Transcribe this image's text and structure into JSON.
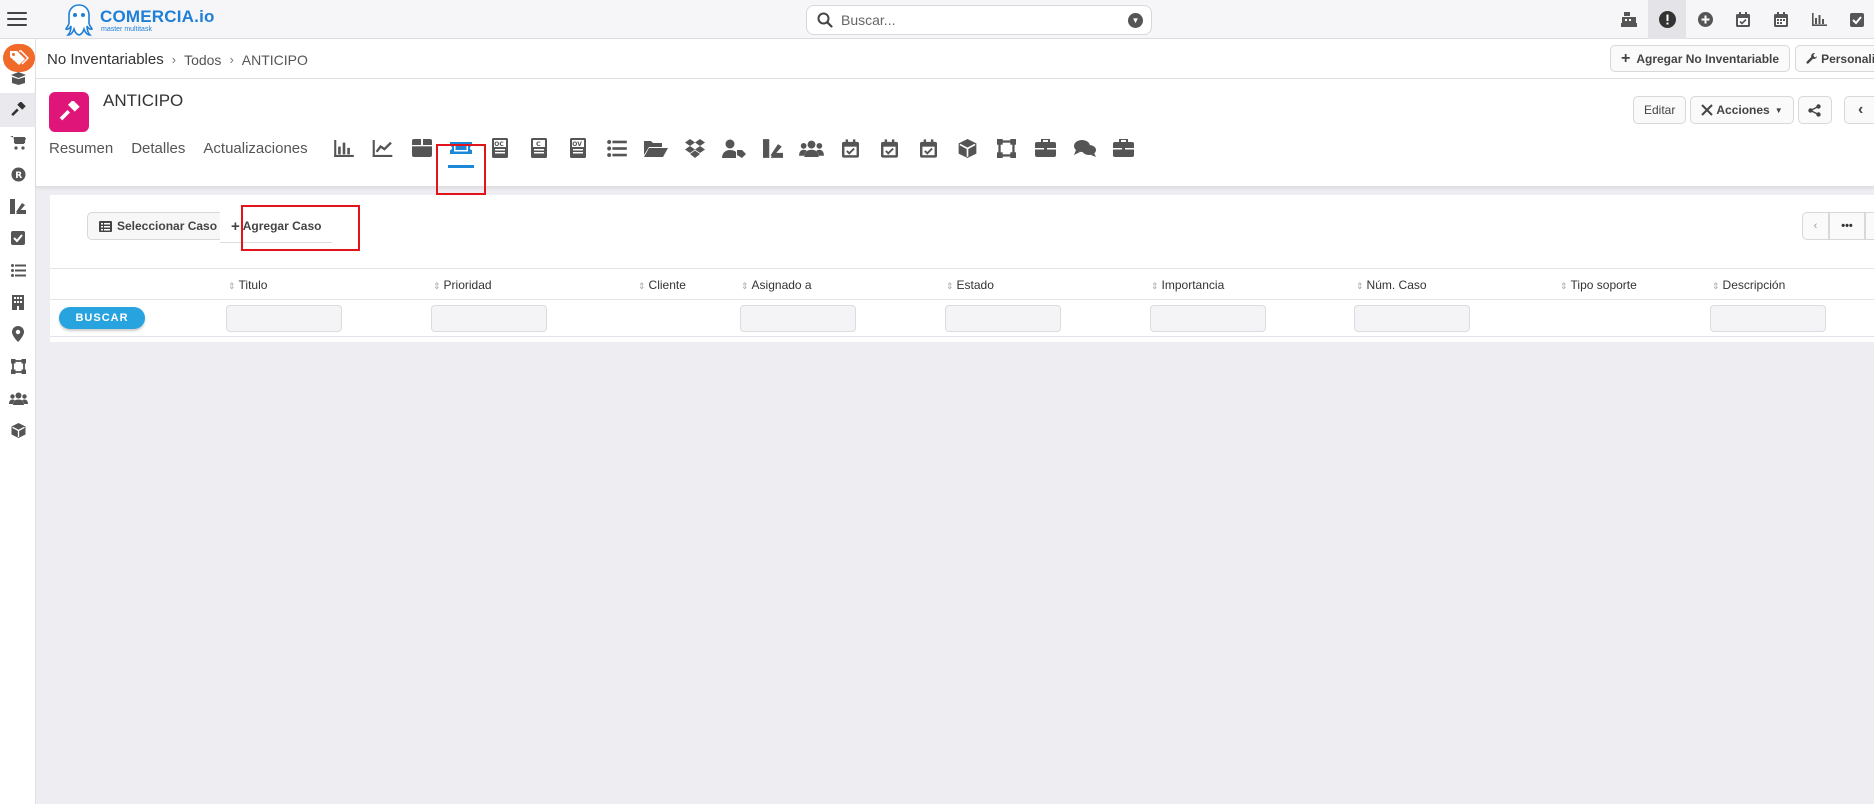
{
  "topbar": {
    "brand_name": "COMERCIA.io",
    "brand_tagline": "master multitask",
    "search_placeholder": "Buscar...",
    "icons": [
      "cash-register-icon",
      "alert-icon",
      "plus-circle-icon",
      "calendar-check-icon",
      "calendar-icon",
      "bar-chart-icon",
      "checkbox-icon"
    ]
  },
  "sidebar": {
    "items": [
      "tag-icon",
      "box-open-icon",
      "hammer-icon",
      "cart-icon",
      "r-circle-icon",
      "swatch-icon",
      "check-square-icon",
      "list-icon",
      "building-icon",
      "map-pin-icon",
      "vector-icon",
      "users-icon",
      "cube-icon"
    ]
  },
  "breadcrumb": {
    "root": "No Inventariables",
    "level2": "Todos",
    "current": "ANTICIPO"
  },
  "crumb_actions": {
    "add_label": "Agregar No Inventariable",
    "personalize_label": "Personali"
  },
  "record": {
    "title": "ANTICIPO",
    "edit_label": "Editar",
    "actions_label": "Acciones",
    "tabs": {
      "summary": "Resumen",
      "details": "Detalles",
      "updates": "Actualizaciones"
    },
    "icon_tabs": [
      "bar-chart-icon",
      "line-chart-icon",
      "box-icon",
      "ticket-icon",
      "oc-doc-icon",
      "c-doc-icon",
      "ov-doc-icon",
      "list-icon",
      "folder-open-icon",
      "dropbox-icon",
      "user-tag-icon",
      "swatch-icon",
      "users-icon",
      "calendar-check-icon",
      "calendar-check-icon",
      "calendar-check-icon",
      "cube-icon",
      "vector-icon",
      "briefcase-icon",
      "comments-icon",
      "briefcase-icon"
    ],
    "active_icon_tab": "ticket-icon"
  },
  "panel": {
    "select_label": "Seleccionar Caso",
    "add_label": "Agregar Caso",
    "search_button": "BUSCAR",
    "columns": [
      "Titulo",
      "Prioridad",
      "Cliente",
      "Asignado a",
      "Estado",
      "Importancia",
      "Núm. Caso",
      "Tipo soporte",
      "Descripción"
    ]
  },
  "colors": {
    "accent": "#1e88d8",
    "brand_badge": "#f06a2a",
    "record_icon": "#e0157a",
    "highlight": "#e2141b",
    "search_button": "#27a3e0"
  }
}
